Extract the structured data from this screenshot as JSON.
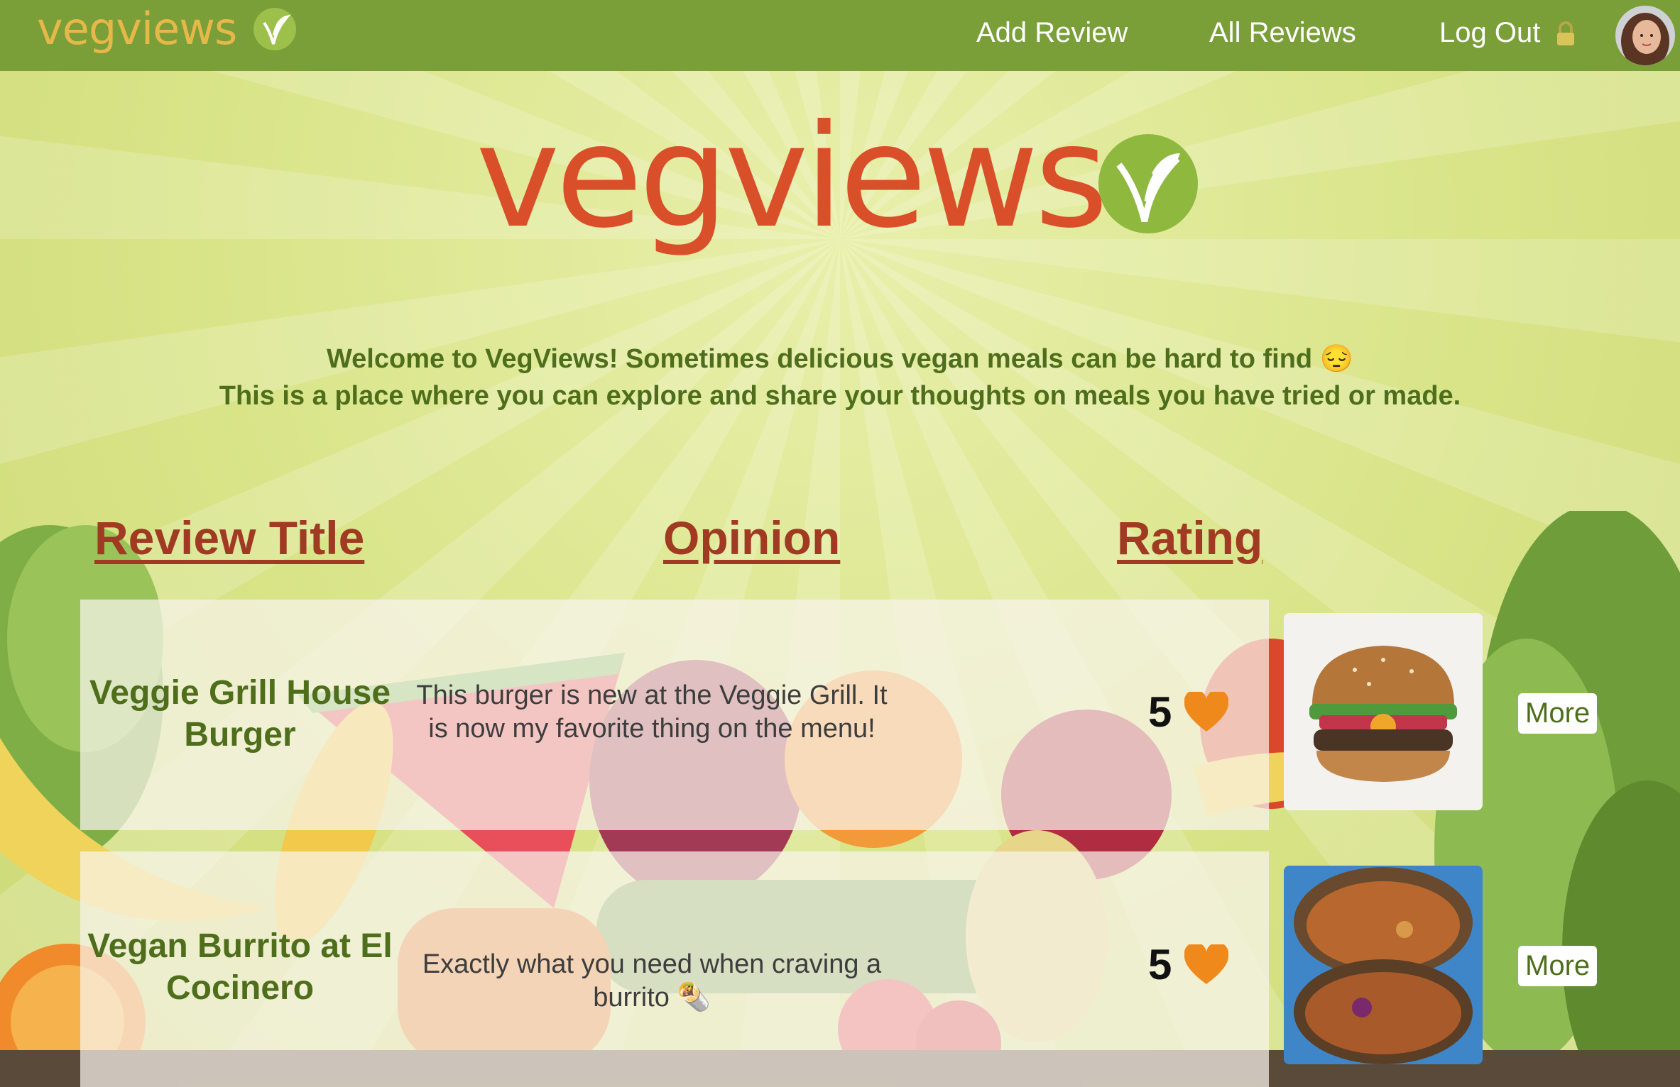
{
  "nav": {
    "logo_text": "vegviews",
    "add_review": "Add Review",
    "all_reviews": "All Reviews",
    "log_out": "Log Out"
  },
  "hero": {
    "title": "vegviews",
    "intro_line1": "Welcome to VegViews! Sometimes delicious vegan meals can be hard to find 😔",
    "intro_line2": "This is a place where you can explore and share your thoughts on meals you have tried or made."
  },
  "table": {
    "headers": {
      "title": "Review Title",
      "opinion": "Opinion",
      "rating": "Rating"
    },
    "rows": [
      {
        "title": "Veggie Grill House Burger",
        "opinion": "This burger is new at the Veggie Grill. It is now my favorite thing on the menu!",
        "rating": "5",
        "more": "More"
      },
      {
        "title": "Vegan Burrito at El Cocinero",
        "opinion": "Exactly what you need when craving a burrito 🌯",
        "rating": "5",
        "more": "More"
      }
    ]
  },
  "colors": {
    "nav_bg": "#7a9e38",
    "logo_gold": "#e6b84a",
    "hero_orange": "#d94f2a",
    "text_green": "#4f6e1c",
    "header_red": "#a03a22",
    "heart_orange": "#f0891c"
  },
  "icons": [
    "vegan-leaf-icon",
    "lock-icon",
    "heart-icon"
  ]
}
